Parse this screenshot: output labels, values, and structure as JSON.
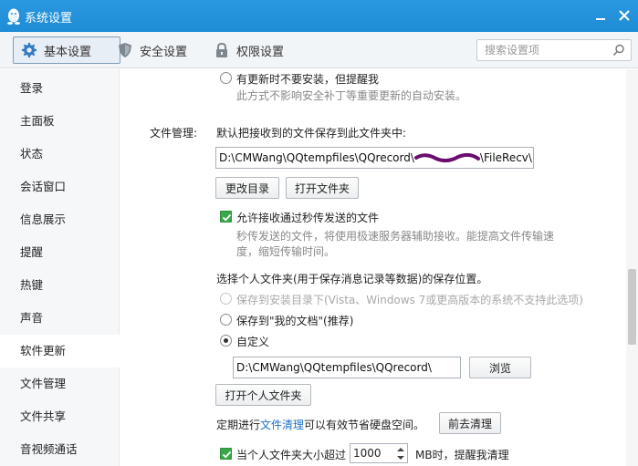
{
  "window": {
    "title": "系统设置",
    "accent": "#2192dc"
  },
  "tabs": [
    {
      "label": "基本设置",
      "icon": "gear-icon",
      "active": true
    },
    {
      "label": "安全设置",
      "icon": "shield-icon"
    },
    {
      "label": "权限设置",
      "icon": "lock-icon"
    }
  ],
  "search": {
    "placeholder": "搜索设置项",
    "value": ""
  },
  "sidebar": {
    "items": [
      {
        "label": "登录"
      },
      {
        "label": "主面板"
      },
      {
        "label": "状态"
      },
      {
        "label": "会话窗口"
      },
      {
        "label": "信息展示"
      },
      {
        "label": "提醒"
      },
      {
        "label": "热键"
      },
      {
        "label": "声音"
      },
      {
        "label": "软件更新",
        "active": true
      },
      {
        "label": "文件管理"
      },
      {
        "label": "文件共享"
      },
      {
        "label": "音视频通话"
      }
    ]
  },
  "update": {
    "option_notify_label": "有更新时不要安装，但提醒我",
    "option_notify_desc": "此方式不影响安全补丁等重要更新的自动安装。"
  },
  "file_mgmt": {
    "section_label": "文件管理:",
    "default_folder_label": "默认把接收到的文件保存到此文件夹中:",
    "path_prefix": "D:\\CMWang\\QQtempfiles\\QQrecord\\",
    "path_suffix": "\\FileRecv\\",
    "change_dir_button": "更改目录",
    "open_folder_button": "打开文件夹",
    "allow_fast_transfer_label": "允许接收通过秒传发送的文件",
    "allow_fast_transfer_checked": true,
    "fast_transfer_desc_1": "秒传发送的文件，将使用极速服务器辅助接收。能提高文件传输速",
    "fast_transfer_desc_2": "度，缩短传输时间。",
    "personal_folder_title": "选择个人文件夹(用于保存消息记录等数据)的保存位置。",
    "opt_install_dir": "保存到安装目录下(Vista、Windows 7或更高版本的系统不支持此选项)",
    "opt_my_documents": "保存到\"我的文档\"(推荐)",
    "opt_custom": "自定义",
    "custom_path": "D:\\CMWang\\QQtempfiles\\QQrecord\\",
    "browse_button": "浏览",
    "open_personal_folder_button": "打开个人文件夹",
    "cleanup_text_prefix": "定期进行",
    "cleanup_link": "文件清理",
    "cleanup_text_suffix": "可以有效节省硬盘空间。",
    "go_cleanup_button": "前去清理",
    "size_limit_label": "当个人文件夹大小超过",
    "size_limit_value": "1000",
    "size_limit_suffix": "MB时，提醒我清理",
    "size_limit_checked": true
  }
}
